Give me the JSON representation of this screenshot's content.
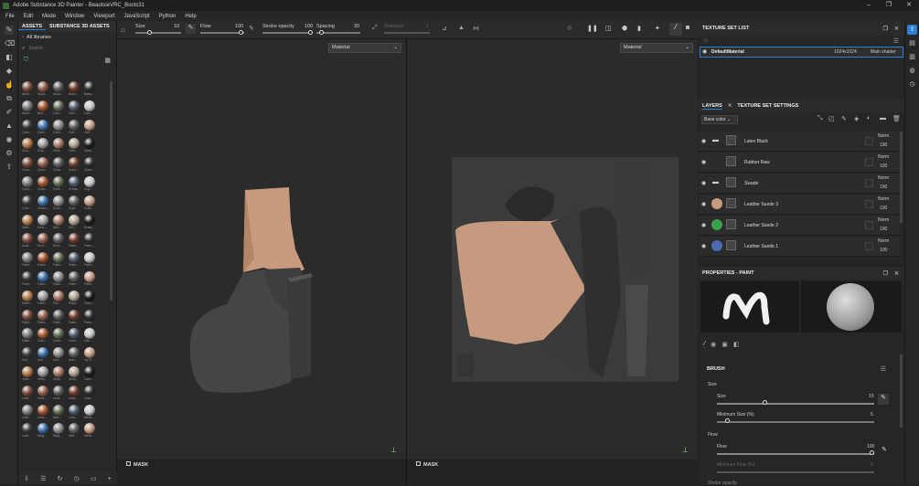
{
  "app": {
    "title": "Adobe Substance 3D Painter - BeautsieVRC_Boots31",
    "menu": [
      "File",
      "Edit",
      "Mode",
      "Window",
      "Viewport",
      "JavaScript",
      "Python",
      "Help"
    ]
  },
  "toolbar": {
    "size_label": "Size",
    "size_value": "10",
    "flow_label": "Flow",
    "flow_value": "100",
    "opacity_label": "Stroke opacity",
    "opacity_value": "100",
    "spacing_label": "Spacing",
    "spacing_value": "20",
    "distance_label": "Distance",
    "distance_value": "1"
  },
  "assets": {
    "tab1": "ASSETS",
    "tab2": "SUBSTANCE 3D ASSETS",
    "library": "All libraries",
    "search_placeholder": "Search",
    "items": [
      [
        "Alum...",
        "Anod...",
        "Alum...",
        "Alum...",
        "Baba..."
      ],
      [
        "Alum...",
        "Bull...",
        "Cart...",
        "Cart...",
        "Carr..."
      ],
      [
        "Carb...",
        "Carb...",
        "Carb...",
        "Cell...",
        "Cell..."
      ],
      [
        "Cha...",
        "Cha...",
        "Clea...",
        "Clea...",
        "Clea..."
      ],
      [
        "Conc...",
        "Conc...",
        "Conc...",
        "Conc...",
        "Conc..."
      ],
      [
        "Conc...",
        "Conc...",
        "Cork...",
        "Creas...",
        "Cup..."
      ],
      [
        "Cork...",
        "Cours...",
        "Croc...",
        "Crys...",
        "Cust..."
      ],
      [
        "Dark...",
        "Desi...",
        "Dirt...",
        "Dirt...",
        "Draw..."
      ],
      [
        "Dust...",
        "Emo...",
        "Emo...",
        "Fabri...",
        "Fabri..."
      ],
      [
        "Fabri...",
        "Fabri...",
        "Fabri...",
        "Fabri...",
        "Fabri..."
      ],
      [
        "Fabri...",
        "Fabri...",
        "Fabri...",
        "Fabri...",
        "Fabri..."
      ],
      [
        "Fabri...",
        "Fabri...",
        "Pla...",
        "Plast...",
        "Fabri..."
      ],
      [
        "Fabri...",
        "Fabri...",
        "Fabri...",
        "Fabri...",
        "Fabri..."
      ],
      [
        "Glitte...",
        "Gold...",
        "Gran...",
        "Grou...",
        "Gro..."
      ],
      [
        "Iron...",
        "Iron...",
        "Iron...",
        "Iron...",
        "Ivy S..."
      ],
      [
        "Jean...",
        "Jersi...",
        "Jersi...",
        "Jersi...",
        "Lace..."
      ],
      [
        "Leat...",
        "Leat...",
        "Leat...",
        "Leat...",
        "Leat..."
      ],
      [
        "Leat...",
        "Leat...",
        "Met...",
        "Leat...",
        "Meta..."
      ],
      [
        "Leat...",
        "Mag...",
        "Mag...",
        "Mat...",
        "Meta..."
      ]
    ]
  },
  "viewport": {
    "left_mode": "Material",
    "right_mode": "Material",
    "mask_label": "MASK"
  },
  "texture_set_list": {
    "title": "TEXTURE SET LIST",
    "material": "DefaultMaterial",
    "resolution": "1024x1024",
    "shader": "Main shader"
  },
  "layers": {
    "tab1": "LAYERS",
    "tab2": "TEXTURE SET SETTINGS",
    "channel": "Base color",
    "rows": [
      {
        "name": "Latex Black",
        "blend": "Norm",
        "opacity": "100"
      },
      {
        "name": "Rubber Raw",
        "blend": "Norm",
        "opacity": "100"
      },
      {
        "name": "Swade",
        "blend": "Norm",
        "opacity": "100"
      },
      {
        "name": "Leather Suede 3",
        "blend": "Norm",
        "opacity": "100"
      },
      {
        "name": "Leather Suede 2",
        "blend": "Norm",
        "opacity": "100"
      },
      {
        "name": "Leather Suede 1",
        "blend": "Norm",
        "opacity": "100"
      }
    ]
  },
  "properties": {
    "title": "PROPERTIES - PAINT",
    "section": "BRUSH",
    "size_group": "Size",
    "size_label": "Size",
    "size_value": "10",
    "min_size_label": "Minimum Size (%)",
    "min_size_value": "5",
    "flow_group": "Flow",
    "flow_label": "Flow",
    "flow_value": "100",
    "min_flow_label": "Minimum Flow (%)",
    "min_flow_value": "0",
    "stroke_label": "Stroke opacity"
  },
  "colors": {
    "accent": "#2f7fd9",
    "ball_palette": [
      "#8a5a4a",
      "#9a6b60",
      "#b9b9b9",
      "#c9a080",
      "#a0a0a0",
      "#555",
      "#303030",
      "#3a7bbf",
      "#6b8a3a",
      "#c04040",
      "#d8d8d8"
    ]
  }
}
